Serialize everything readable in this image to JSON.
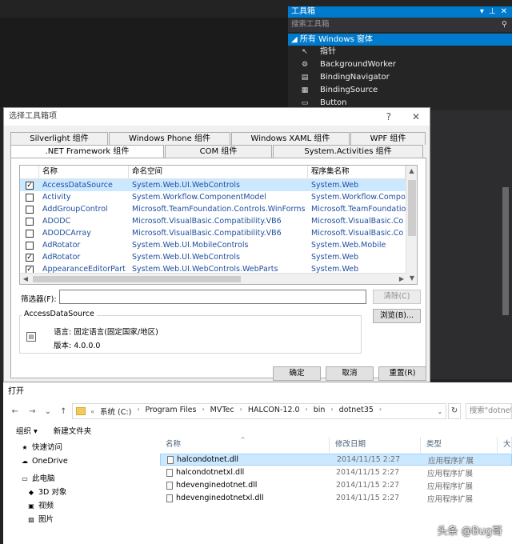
{
  "toolbox": {
    "title": "工具箱",
    "search_placeholder": "搜索工具箱",
    "group_label": "所有 Windows 窗体",
    "items": [
      {
        "icon": "pointer-icon",
        "glyph": "↖",
        "label": "指针"
      },
      {
        "icon": "background-worker-icon",
        "glyph": "⚙",
        "label": "BackgroundWorker"
      },
      {
        "icon": "binding-navigator-icon",
        "glyph": "▤",
        "label": "BindingNavigator"
      },
      {
        "icon": "binding-source-icon",
        "glyph": "▦",
        "label": "BindingSource"
      },
      {
        "icon": "button-icon",
        "glyph": "▭",
        "label": "Button"
      }
    ]
  },
  "choose_dialog": {
    "title": "选择工具箱项",
    "help_glyph": "?",
    "close_glyph": "✕",
    "tabs_row1": [
      "Silverlight 组件",
      "Windows Phone 组件",
      "Windows XAML 组件",
      "WPF 组件"
    ],
    "tabs_row2": [
      ".NET Framework 组件",
      "COM 组件",
      "System.Activities 组件"
    ],
    "active_tab": ".NET Framework 组件",
    "columns": {
      "name": "名称",
      "namespace": "命名空间",
      "assembly": "程序集名称"
    },
    "rows": [
      {
        "checked": true,
        "selected": true,
        "name": "AccessDataSource",
        "namespace": "System.Web.UI.WebControls",
        "assembly": "System.Web"
      },
      {
        "checked": false,
        "selected": false,
        "name": "Activity",
        "namespace": "System.Workflow.ComponentModel",
        "assembly": "System.Workflow.Compo"
      },
      {
        "checked": false,
        "selected": false,
        "name": "AddGroupControl",
        "namespace": "Microsoft.TeamFoundation.Controls.WinForms",
        "assembly": "Microsoft.TeamFoundatio"
      },
      {
        "checked": false,
        "selected": false,
        "name": "ADODC",
        "namespace": "Microsoft.VisualBasic.Compatibility.VB6",
        "assembly": "Microsoft.VisualBasic.Co"
      },
      {
        "checked": false,
        "selected": false,
        "name": "ADODCArray",
        "namespace": "Microsoft.VisualBasic.Compatibility.VB6",
        "assembly": "Microsoft.VisualBasic.Co"
      },
      {
        "checked": false,
        "selected": false,
        "name": "AdRotator",
        "namespace": "System.Web.UI.MobileControls",
        "assembly": "System.Web.Mobile"
      },
      {
        "checked": true,
        "selected": false,
        "name": "AdRotator",
        "namespace": "System.Web.UI.WebControls",
        "assembly": "System.Web"
      },
      {
        "checked": true,
        "selected": false,
        "name": "AppearanceEditorPart",
        "namespace": "System.Web.UI.WebControls.WebParts",
        "assembly": "System.Web"
      }
    ],
    "filter_label": "筛选器(F):",
    "filter_value": "",
    "clear_button": "清除(C)",
    "browse_button": "浏览(B)...",
    "details": {
      "title": "AccessDataSource",
      "language": "语言:  固定语言(固定国家/地区)",
      "version": "版本:  4.0.0.0"
    },
    "ok_button": "确定",
    "cancel_button": "取消",
    "reset_button": "重置(R)"
  },
  "open_dialog": {
    "title": "打开",
    "address_prefix": "«",
    "breadcrumbs": [
      "系统 (C:)",
      "Program Files",
      "MVTec",
      "HALCON-12.0",
      "bin",
      "dotnet35"
    ],
    "search_placeholder": "搜索\"dotnet",
    "organize_label": "组织 ▾",
    "new_folder_label": "新建文件夹",
    "nav_items": [
      {
        "icon": "star-icon",
        "glyph": "★",
        "label": "快速访问",
        "indent": false
      },
      {
        "icon": "cloud-icon",
        "glyph": "☁",
        "label": "OneDrive",
        "indent": false
      },
      {
        "icon": "computer-icon",
        "glyph": "▭",
        "label": "此电脑",
        "indent": false
      },
      {
        "icon": "cube-icon",
        "glyph": "◆",
        "label": "3D 对象",
        "indent": true
      },
      {
        "icon": "video-icon",
        "glyph": "▣",
        "label": "视频",
        "indent": true
      },
      {
        "icon": "picture-icon",
        "glyph": "▨",
        "label": "图片",
        "indent": true
      }
    ],
    "columns": {
      "name": "名称",
      "date": "修改日期",
      "type": "类型",
      "size": "大小"
    },
    "files": [
      {
        "name": "halcondotnet.dll",
        "date": "2014/11/15 2:27",
        "type": "应用程序扩展",
        "selected": true
      },
      {
        "name": "halcondotnetxl.dll",
        "date": "2014/11/15 2:27",
        "type": "应用程序扩展",
        "selected": false
      },
      {
        "name": "hdevenginedotnet.dll",
        "date": "2014/11/15 2:27",
        "type": "应用程序扩展",
        "selected": false
      },
      {
        "name": "hdevenginedotnetxl.dll",
        "date": "2014/11/15 2:27",
        "type": "应用程序扩展",
        "selected": false
      }
    ]
  },
  "watermark": "头条 @Bug哥",
  "colors": {
    "vs_accent": "#007acc",
    "selection": "#cce8ff",
    "link_blue": "#1f4fa0"
  }
}
